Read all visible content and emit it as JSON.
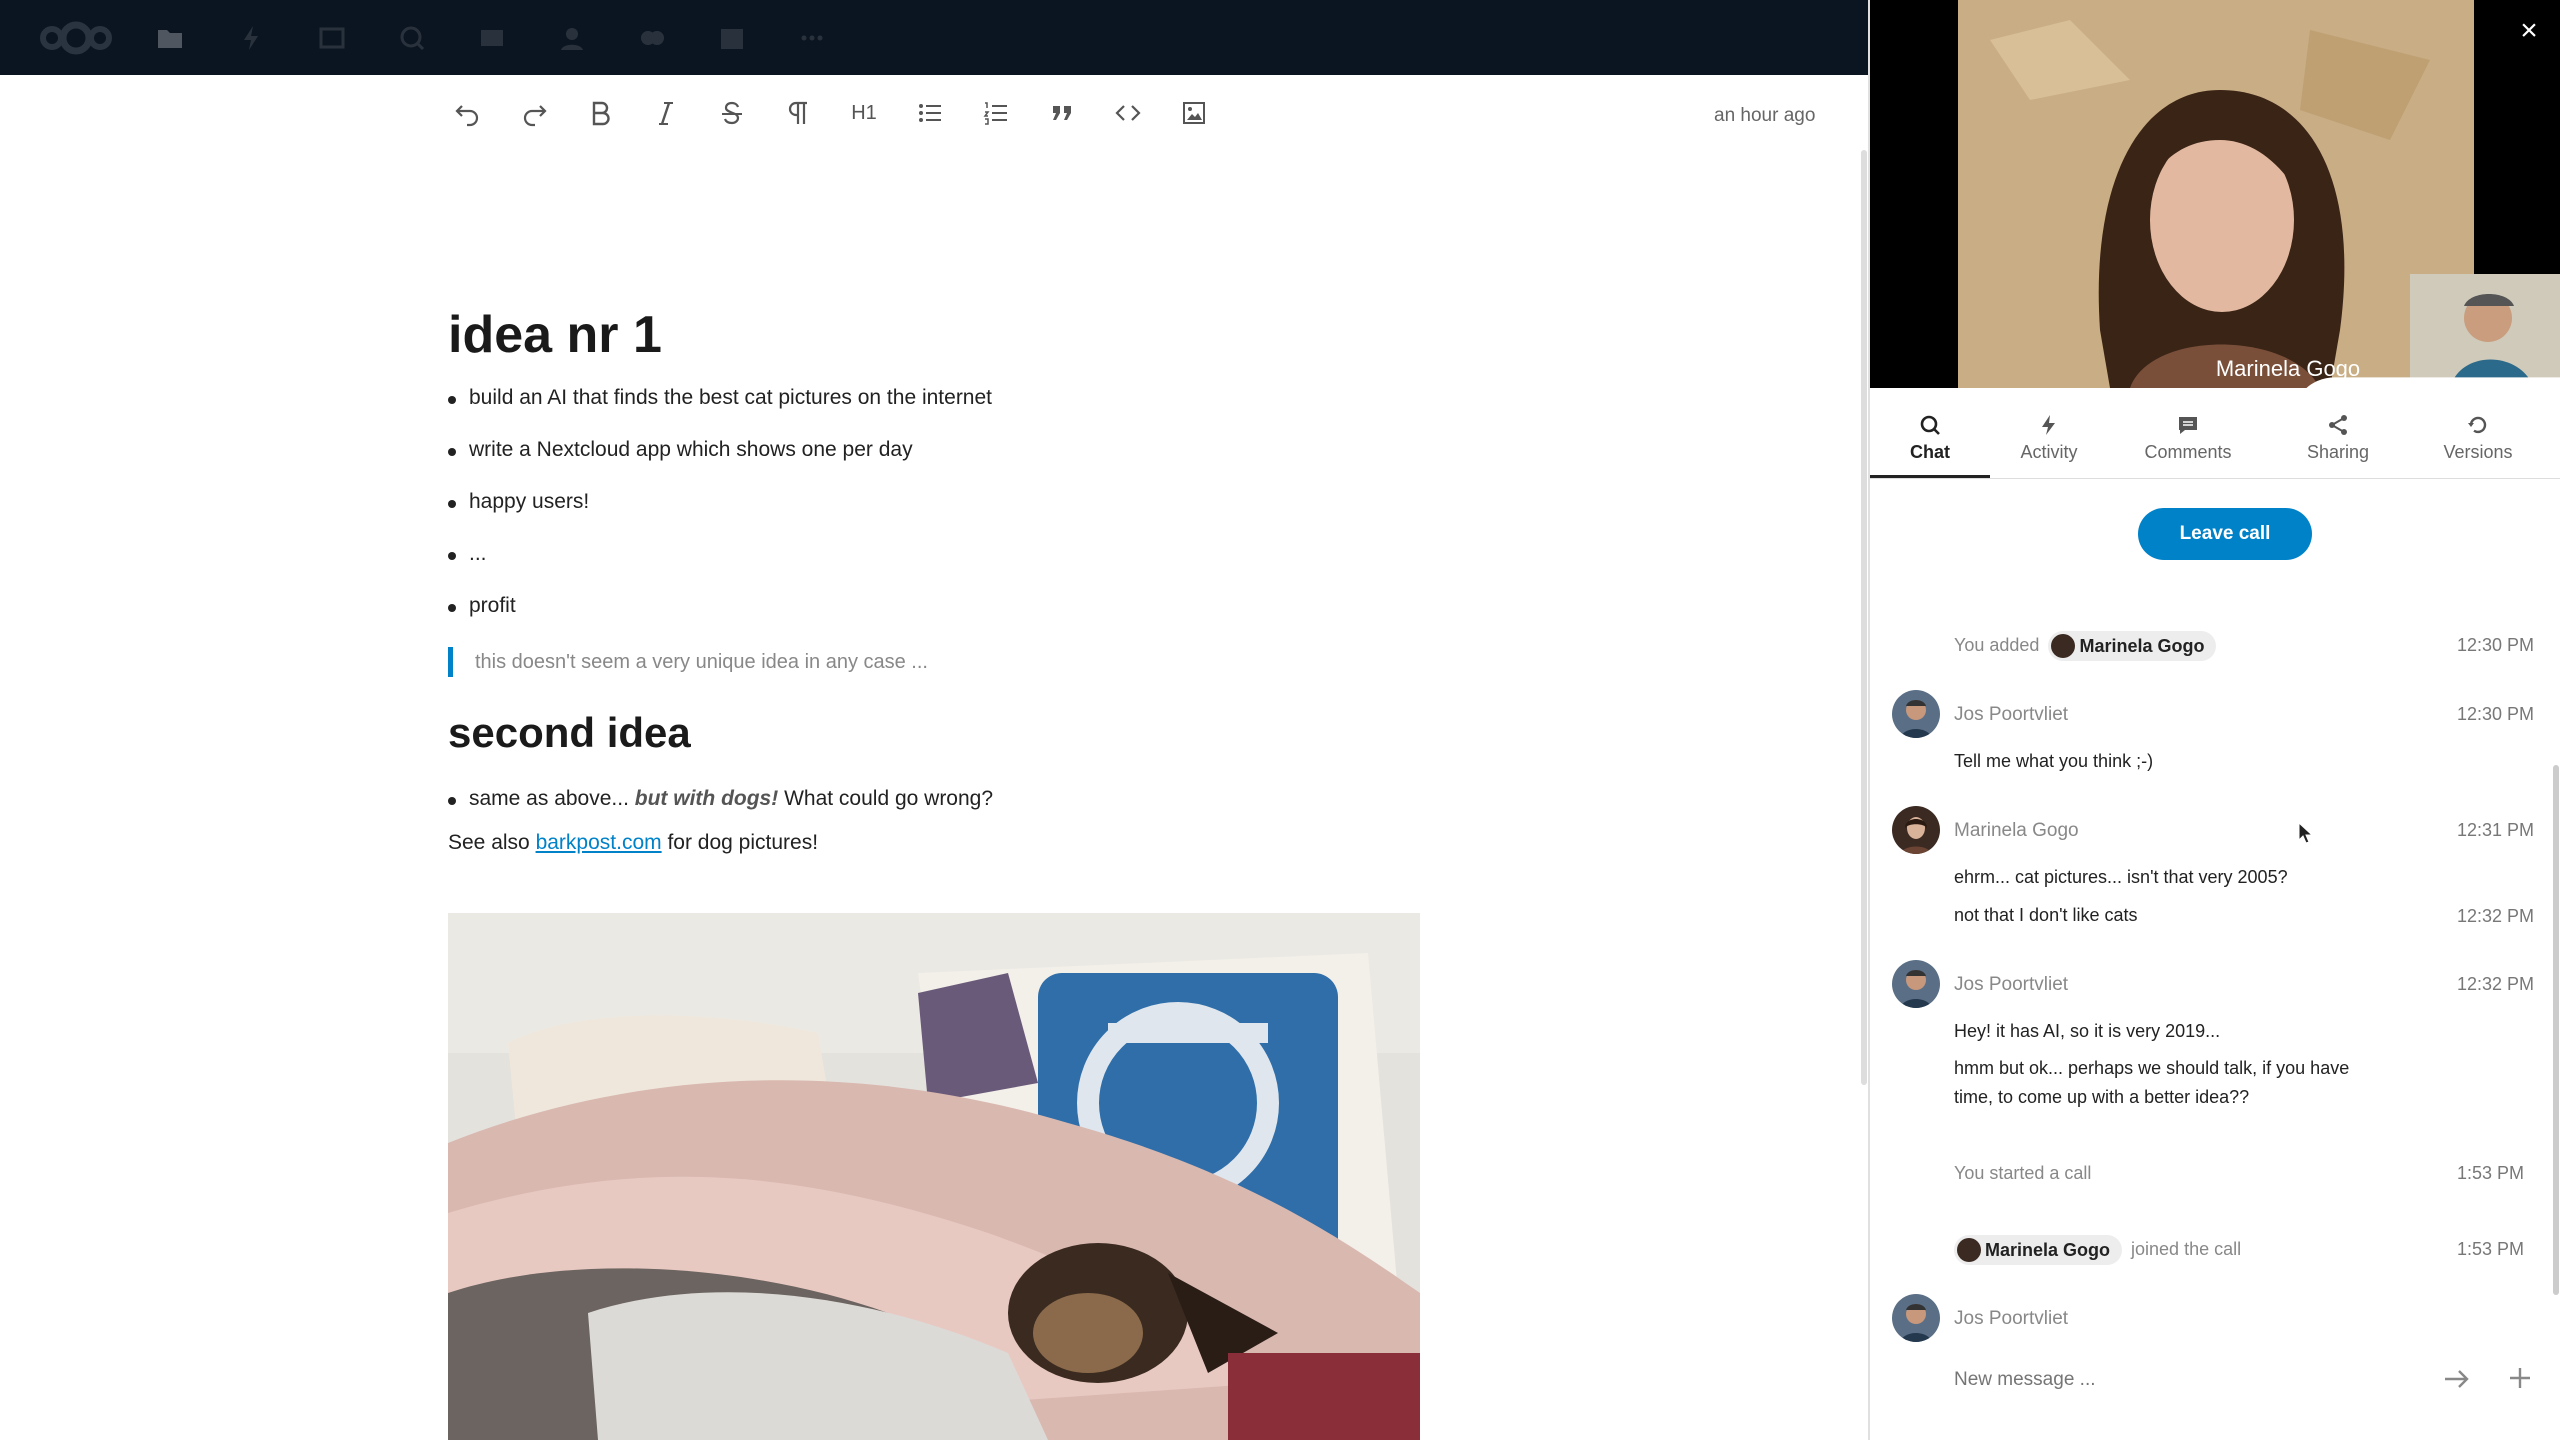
{
  "toolbar": {
    "icons": [
      "undo-icon",
      "redo-icon",
      "bold-icon",
      "italic-icon",
      "strikethrough-icon",
      "paragraph-icon",
      "heading-icon",
      "bullet-list-icon",
      "numbered-list-icon",
      "blockquote-icon",
      "code-icon",
      "insert-image-icon"
    ],
    "heading_label": "H1",
    "last_saved": "an hour ago"
  },
  "document": {
    "h1": "idea nr 1",
    "list1": [
      "build an AI that finds the best cat pictures on the internet",
      "write a Nextcloud app which shows one per day",
      "happy users!",
      "...",
      "profit"
    ],
    "quote": "this doesn't seem a very unique idea in any case ...",
    "h2": "second idea",
    "list2_prefix": "same as above... ",
    "list2_emph": "but with dogs!",
    "list2_suffix": " What could go wrong?",
    "para_prefix": "See also ",
    "para_link": "barkpost.com",
    "para_suffix": " for dog pictures!"
  },
  "call": {
    "participant_name": "Marinela Gogo",
    "close_label": "×"
  },
  "tabs": [
    {
      "label": "Chat",
      "icon": "search-icon"
    },
    {
      "label": "Activity",
      "icon": "flash-icon"
    },
    {
      "label": "Comments",
      "icon": "comment-icon"
    },
    {
      "label": "Sharing",
      "icon": "share-icon"
    },
    {
      "label": "Versions",
      "icon": "history-icon"
    }
  ],
  "leave_call_label": "Leave call",
  "chat": {
    "sys1_prefix": "You added",
    "sys1_chip": "Marinela Gogo",
    "sys1_time": "12:30 PM",
    "m1_author": "Jos Poortvliet",
    "m1_time": "12:30 PM",
    "m1_text": "Tell me what you think ;-)",
    "m2_author": "Marinela Gogo",
    "m2_time": "12:31 PM",
    "m2_text1": "ehrm... cat pictures... isn't that very 2005?",
    "m2_text2": "not that I don't like cats",
    "m2_time2": "12:32 PM",
    "m3_author": "Jos Poortvliet",
    "m3_time": "12:32 PM",
    "m3_text1": "Hey! it has AI, so it is very 2019...",
    "m3_text2": "hmm but ok... perhaps we should talk, if you have time, to come up with a better idea??",
    "sys2_text": "You started a call",
    "sys2_time": "1:53 PM",
    "sys3_chip": "Marinela Gogo",
    "sys3_suffix": "joined the call",
    "sys3_time": "1:53 PM",
    "m4_author": "Jos Poortvliet"
  },
  "composer": {
    "placeholder": "New message ..."
  },
  "colors": {
    "header": "#0b1521",
    "accent": "#0082c9"
  }
}
